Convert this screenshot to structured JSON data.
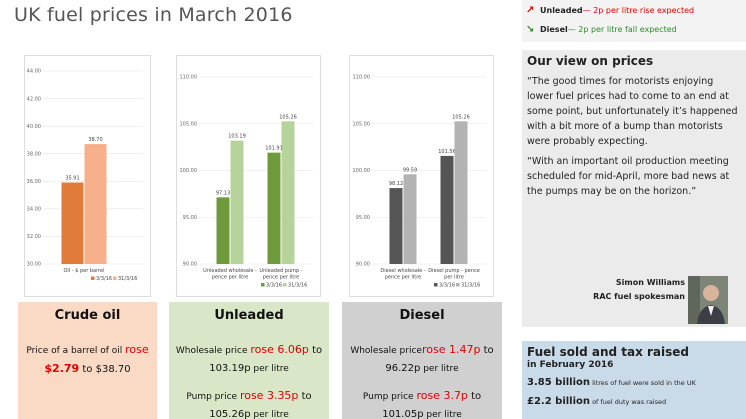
{
  "title": "UK fuel prices in March 2016",
  "colors": {
    "crude_dark": "#e07b39",
    "crude_light": "#f7b08a",
    "unleaded_dark": "#6e9a3c",
    "unleaded_light": "#b5d39a",
    "diesel_dark": "#555555",
    "diesel_light": "#b3b3b3",
    "crude_card": "#fad9c5",
    "unleaded_card": "#d9e6c7",
    "diesel_card": "#d0d0d0",
    "red": "#e00000",
    "green": "#2e8b2e"
  },
  "chart_data": [
    {
      "type": "bar",
      "categories": [
        "Oil - $ per barrel"
      ],
      "series": [
        {
          "name": "3/3/16",
          "values": [
            35.91
          ]
        },
        {
          "name": "31/3/16",
          "values": [
            38.7
          ]
        }
      ],
      "ylim": [
        30,
        44
      ],
      "yticks": [
        "30.00",
        "32.00",
        "34.00",
        "36.00",
        "38.00",
        "40.00",
        "42.00",
        "44.00"
      ],
      "data_labels": [
        [
          "35.91"
        ],
        [
          "38.70"
        ]
      ],
      "legend": "bottom",
      "grid": true
    },
    {
      "type": "bar",
      "categories": [
        "Unleaded wholesale - pence per litre",
        "Unleaded pump - pence per litre"
      ],
      "category_lines": [
        [
          "Unleaded wholesale -",
          "pence per litre"
        ],
        [
          "Unleaded pump -",
          "pence per litre"
        ]
      ],
      "series": [
        {
          "name": "3/3/16",
          "values": [
            97.13,
            101.91
          ]
        },
        {
          "name": "31/3/16",
          "values": [
            103.19,
            105.26
          ]
        }
      ],
      "ylim": [
        90,
        110
      ],
      "yticks": [
        "90.00",
        "95.00",
        "100.00",
        "105.00",
        "110.00"
      ],
      "data_labels": [
        [
          "97.13",
          "101.91"
        ],
        [
          "103.19",
          "105.26"
        ]
      ],
      "legend": "bottom",
      "grid": true
    },
    {
      "type": "bar",
      "categories": [
        "Diesel wholesale - pence per litre",
        "Diesel pump - pence per litre"
      ],
      "category_lines": [
        [
          "Diesel wholesale -",
          "pence per litre"
        ],
        [
          "Diesel pump - pence",
          "per litre"
        ]
      ],
      "series": [
        {
          "name": "3/3/16",
          "values": [
            98.12,
            101.56
          ]
        },
        {
          "name": "31/3/16",
          "values": [
            99.59,
            105.26
          ]
        }
      ],
      "ylim": [
        90,
        110
      ],
      "yticks": [
        "90.00",
        "95.00",
        "100.00",
        "105.00",
        "110.00"
      ],
      "data_labels": [
        [
          "98.12",
          "101.56"
        ],
        [
          "99.59",
          "105.26"
        ]
      ],
      "legend": "bottom",
      "grid": true
    }
  ],
  "cards": {
    "crude": {
      "heading": "Crude oil",
      "l1_text": "Price of a barrel of oil ",
      "l1_red": "rose",
      "l2_red": "$2.79",
      "l2_text": " to $38.70"
    },
    "unleaded": {
      "heading": "Unleaded",
      "w_text": "Wholesale price ",
      "w_red": "rose 6.06p",
      "w_to": " to",
      "w_val": "103.19p",
      "w_unit": " per litre",
      "p_text": "Pump price ",
      "p_red": "rose 3.35p",
      "p_to": " to",
      "p_val": "105.26p",
      "p_unit": " per litre"
    },
    "diesel": {
      "heading": "Diesel",
      "w_text": "Wholesale price",
      "w_red": "rose 1.47p",
      "w_to": " to",
      "w_val": "96.22p",
      "w_unit": " per litre",
      "p_text": "Pump price ",
      "p_red": "rose 3.7p",
      "p_to": " to",
      "p_val": "101.05p",
      "p_unit": " per litre"
    }
  },
  "legend_box": {
    "unleaded_label": "Unleaded",
    "unleaded_note": " — 2p per litre rise expected",
    "diesel_label": "Diesel",
    "diesel_note": " — 2p per litre fall expected"
  },
  "view": {
    "heading": "Our view on prices",
    "quote1": "“The good times for motorists enjoying lower fuel prices had to come to an end at some point, but unfortunately it’s happened with a bit more of a bump than motorists were probably expecting.",
    "quote2": "“With an important oil production meeting scheduled for mid-April, more bad news at the pumps may be on the horizon.”",
    "name": "Simon Williams",
    "role": "RAC fuel spokesman",
    "photo_icon": "person-photo"
  },
  "fuel": {
    "heading": "Fuel sold and tax raised",
    "sub": "in February 2016",
    "stat1_value": "3.85 billion",
    "stat1_text": " litres of fuel were sold in the UK",
    "stat2_value": "£2.2 billion",
    "stat2_text": " of fuel duty was raised"
  }
}
